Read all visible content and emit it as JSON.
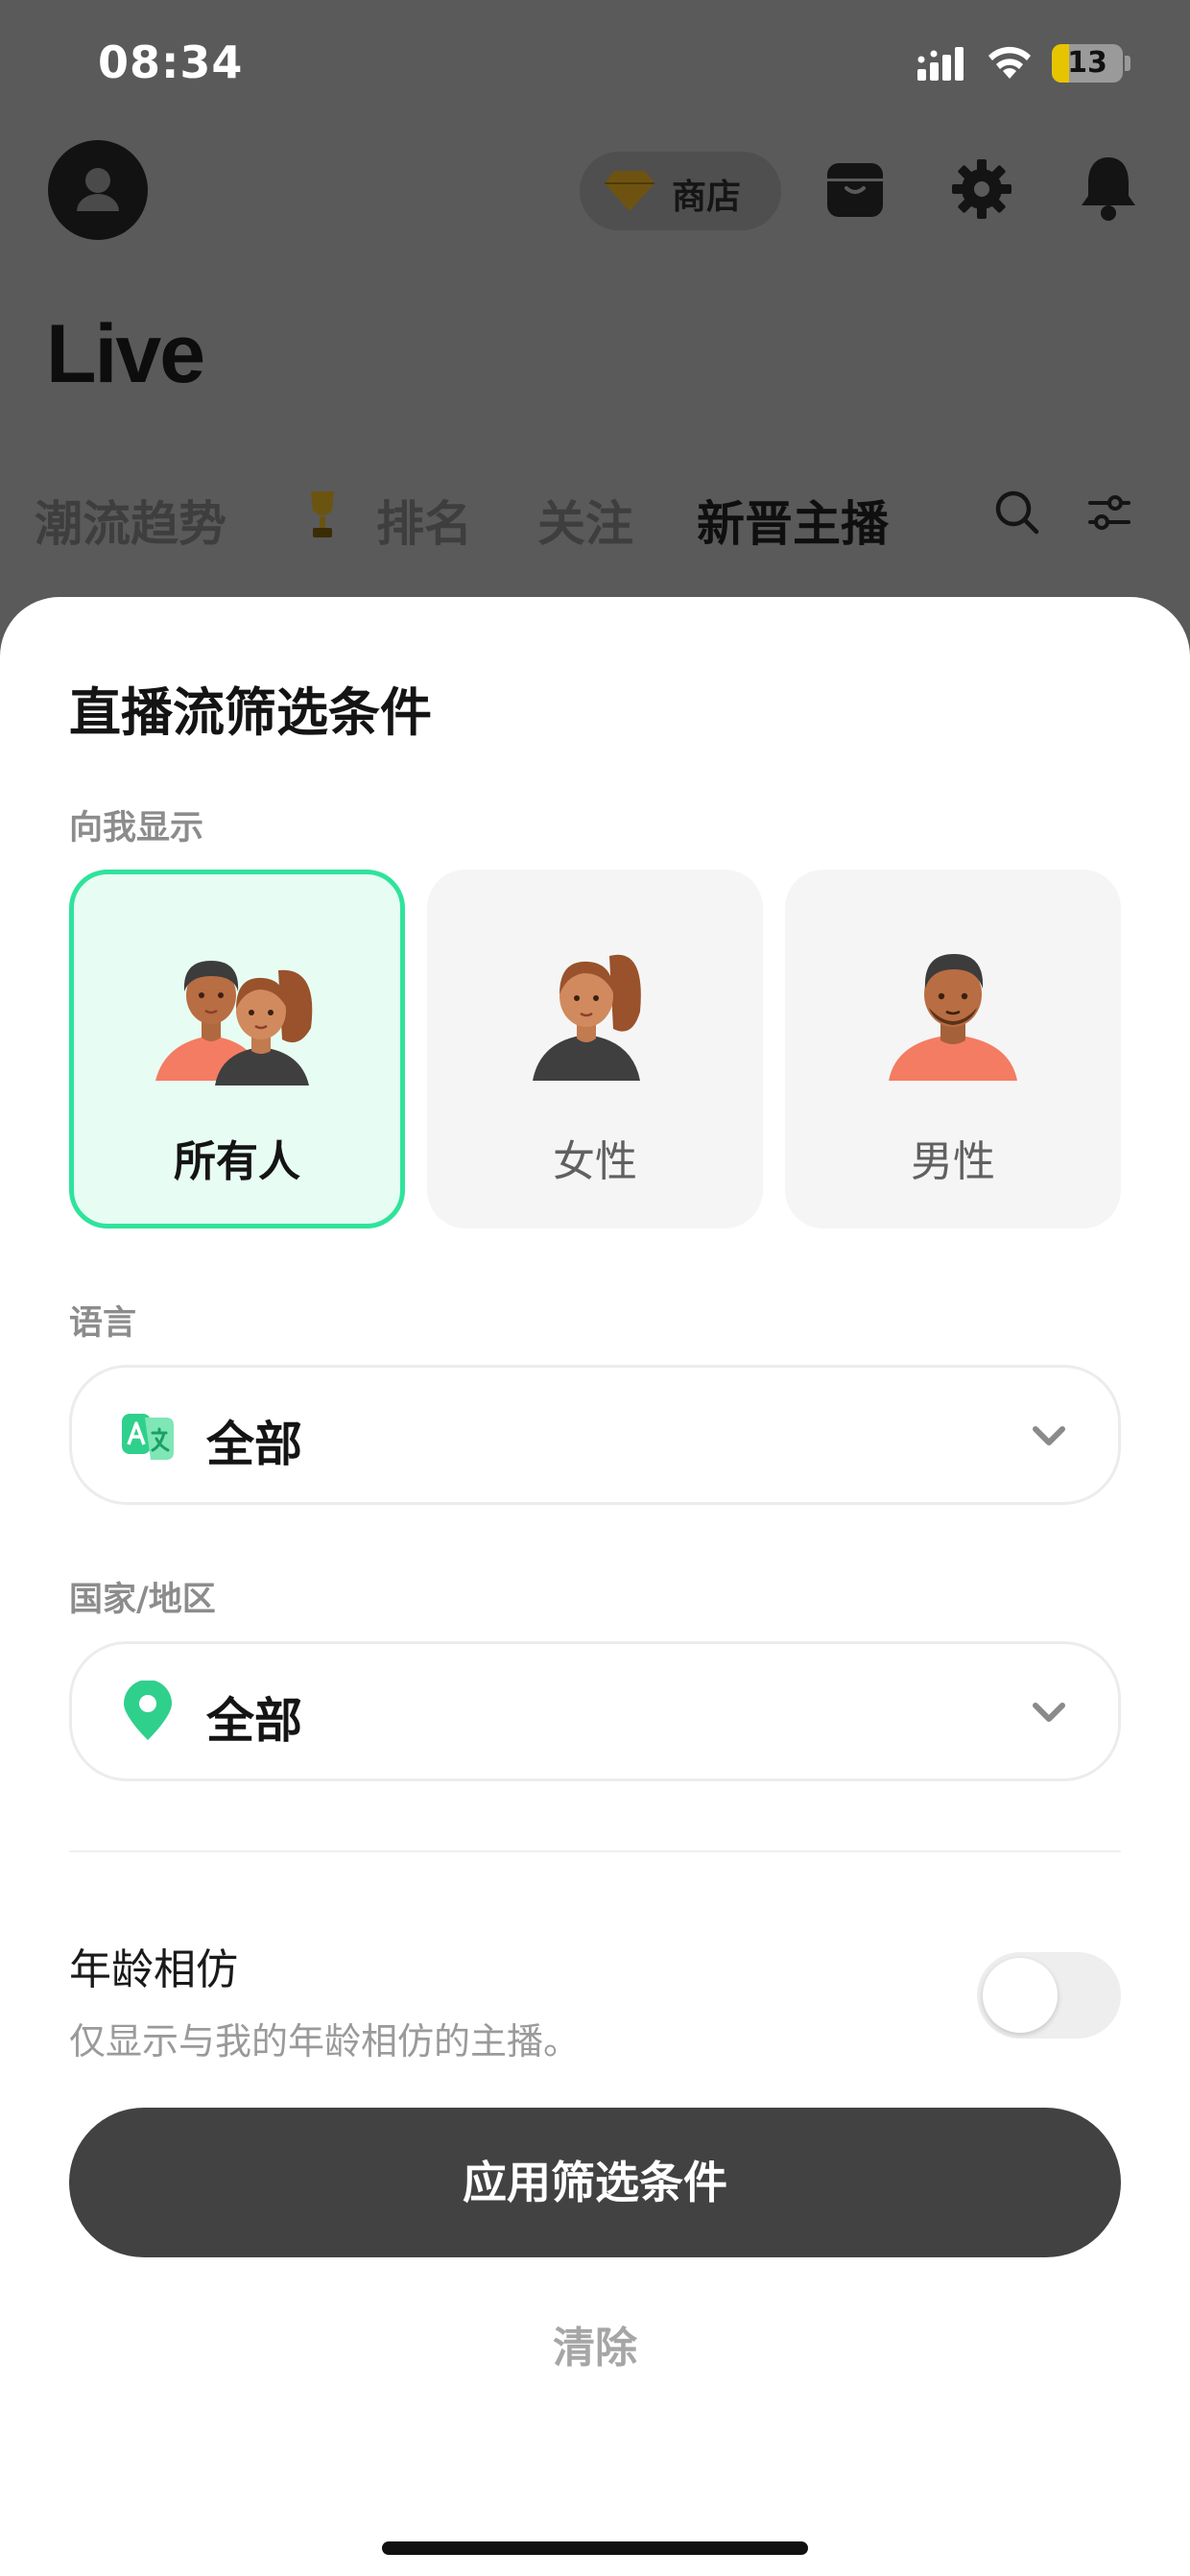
{
  "status_bar": {
    "time": "08:34",
    "battery": "13"
  },
  "header": {
    "store_label": "商店",
    "title": "Live"
  },
  "tabs": [
    {
      "label": "潮流趋势"
    },
    {
      "label": "排名"
    },
    {
      "label": "关注"
    },
    {
      "label": "新晋主播",
      "active": true
    }
  ],
  "sheet": {
    "title": "直播流筛选条件",
    "gender_section_label": "向我显示",
    "gender_options": [
      {
        "label": "所有人",
        "selected": true
      },
      {
        "label": "女性",
        "selected": false
      },
      {
        "label": "男性",
        "selected": false
      }
    ],
    "language_label": "语言",
    "language_value": "全部",
    "country_label": "国家/地区",
    "country_value": "全部",
    "age_title": "年龄相仿",
    "age_description": "仅显示与我的年龄相仿的主播。",
    "age_toggle_on": false,
    "apply_label": "应用筛选条件",
    "clear_label": "清除"
  },
  "colors": {
    "accent_green": "#2fe39b",
    "selected_bg": "#e7fdf3",
    "apply_button": "#424242",
    "dim_overlay": "#5a5a5a"
  }
}
